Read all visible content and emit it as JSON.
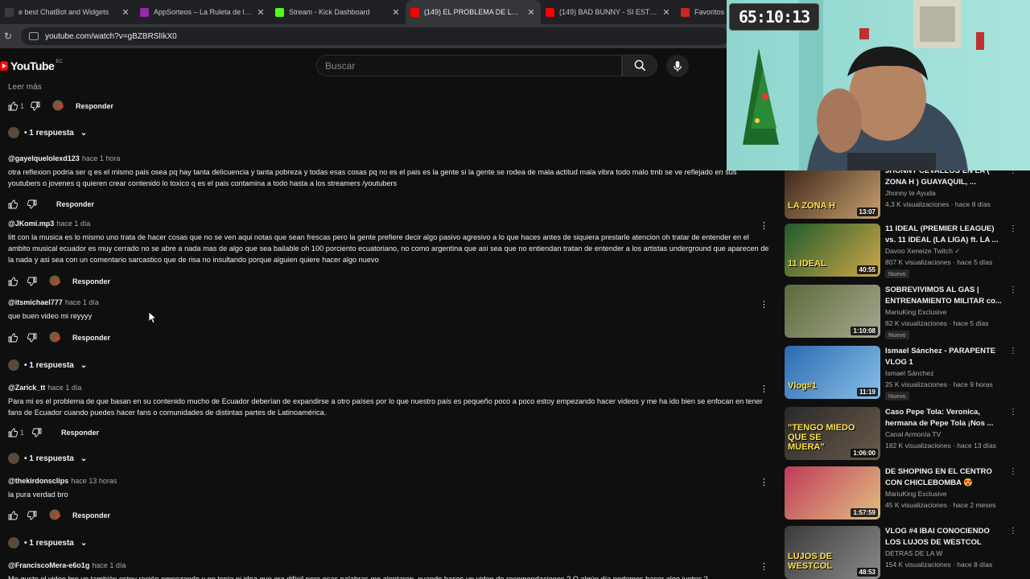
{
  "browser": {
    "tabs": [
      {
        "label": "e best ChatBot and Widgets",
        "color": "#3c3c3c",
        "active": false
      },
      {
        "label": "AppSorteos – La Ruleta de la Su",
        "color": "#9c27b0",
        "active": false
      },
      {
        "label": "Stream - Kick Dashboard",
        "color": "#53fc18",
        "active": false
      },
      {
        "label": "(149) EL PROBLEMA DE LOS STR",
        "color": "#ff0000",
        "active": true
      },
      {
        "label": "(149) BAD BUNNY - SI ESTUVIÉ",
        "color": "#ff0000",
        "active": false
      },
      {
        "label": "Favoritos | Myinst",
        "color": "#c62828",
        "active": false
      }
    ],
    "url": "youtube.com/watch?v=gBZBRSlIkX0"
  },
  "youtube": {
    "logo_text": "YouTube",
    "country_code": "EC",
    "search_placeholder": "Buscar"
  },
  "comments": {
    "read_more": "Leer más",
    "reply_label": "Responder",
    "top_action": {
      "likes": "1"
    },
    "replies_label": "• 1 respuesta",
    "items": [
      {
        "author": "@gayelquelolexd123",
        "time": "hace 1 hora",
        "text": "otra reflexion podria ser q es el mismo pais osea pq hay tanta delicuencia y tanta pobreza y todas esas cosas pq no es el pais es la gente si la gente se rodea de mala actitud mala vibra todo malo tmb se ve reflejado en sus youtubers o jovenes q quieren crear contenido lo toxico q es el pais contamina a todo hasta a los streamers /youtubers",
        "likes": ""
      },
      {
        "author": "@JKomi.mp3",
        "time": "hace 1 día",
        "text": "litt con la musica es lo mismo uno trata de hacer cosas que no se ven aqui notas que sean frescas pero la gente prefiere decir algo pasivo agresivo a lo que haces antes de siquiera prestarle atencion oh tratar de entender en el ambito musical ecuador es muy cerrado no se abre a nada mas de algo que sea bailable oh 100 porciento ecuatoriano, no como argentina que asi sea que no entiendan tratan de entender a los artistas underground que aparecen de la nada y asi sea con un comentario sarcastico que de risa no insultando porque alguien quiere hacer algo nuevo",
        "likes": ""
      },
      {
        "author": "@itsmichael777",
        "time": "hace 1 día",
        "text": "que buen video mi reyyyy",
        "likes": ""
      },
      {
        "author": "@Zarick_tt",
        "time": "hace 1 día",
        "text": "Para mi es el problema de que basan en su contenido mucho de Ecuador deberían de expandirse a otro países por lo que nuestro país es pequeño poco a poco estoy empezando hacer videos y me ha ido bien se enfocan en tener fans de Ecuador cuando puedes hacer fans o comunidades de distintas partes de Latinoamérica.",
        "likes": "1"
      },
      {
        "author": "@thekirdonsclips",
        "time": "hace 13 horas",
        "text": "la pura verdad bro",
        "likes": ""
      },
      {
        "author": "@FranciscoMera-e6o1g",
        "time": "hace 1 día",
        "text": "Me gusto el video bro yo también estoy recién empezando y no tenia ni idea que era difícil pero esas palabras me alentaron, cuando haces un video de recomendaciones ? O algún día podemos hacer algo juntos ?",
        "likes": ""
      }
    ]
  },
  "sidebar": {
    "videos": [
      {
        "title": "JHONNY CEVALLOS EN LA ( ZONA H ) GUAYAQUIL, ...",
        "channel": "Jhonny te Ayuda",
        "stats": "4,3 K visualizaciones · hace 8 días",
        "duration": "13:07",
        "badge": "",
        "thumb_text": "LA ZONA H",
        "colors": [
          "#3a2418",
          "#c8a070"
        ]
      },
      {
        "title": "11 IDEAL (PREMIER LEAGUE) vs. 11 IDEAL (LA LIGA) ft. LA ...",
        "channel": "Davoo Xeneize Twitch ✓",
        "stats": "807 K visualizaciones · hace 5 días",
        "duration": "40:55",
        "badge": "Nuevo",
        "thumb_text": "11 IDEAL",
        "colors": [
          "#1f5a2a",
          "#d0a84a"
        ]
      },
      {
        "title": "SOBREVIVIMOS AL GAS | ENTRENAMIENTO MILITAR co...",
        "channel": "MariuKing Exclusive",
        "stats": "82 K visualizaciones · hace 5 días",
        "duration": "1:10:08",
        "badge": "Nuevo",
        "thumb_text": "",
        "colors": [
          "#5a6a3a",
          "#a8a890"
        ]
      },
      {
        "title": "Ismael Sánchez - PARAPENTE VLOG 1",
        "channel": "Ismael Sánchez",
        "stats": "25 K visualizaciones · hace 9 horas",
        "duration": "11:19",
        "badge": "Nuevo",
        "thumb_text": "Vlog#1",
        "colors": [
          "#2a6ab0",
          "#8ac0e8"
        ]
      },
      {
        "title": "Caso Pepe Tola: Veronica, hermana de Pepe Tola ¡Nos ...",
        "channel": "Canal Armonía TV",
        "stats": "182 K visualizaciones · hace 13 días",
        "duration": "1:06:00",
        "badge": "",
        "thumb_text": "\"TENGO MIEDO QUE SE MUERA\"",
        "colors": [
          "#2a2a2a",
          "#6a5a4a"
        ]
      },
      {
        "title": "DE SHOPING EN EL CENTRO CON CHICLEBOMBA 😍",
        "channel": "MariuKing Exclusive",
        "stats": "45 K visualizaciones · hace 2 meses",
        "duration": "1:57:59",
        "badge": "",
        "thumb_text": "",
        "colors": [
          "#c03a5a",
          "#e0c080"
        ]
      },
      {
        "title": "VLOG #4 IBAI CONOCIENDO LOS LUJOS DE WESTCOL",
        "channel": "DETRAS DE LA W",
        "stats": "154 K visualizaciones · hace 8 días",
        "duration": "48:53",
        "badge": "",
        "thumb_text": "LUJOS DE WESTCOL",
        "colors": [
          "#3a3a3a",
          "#8a8a8a"
        ]
      }
    ]
  },
  "overlay": {
    "timer": "65:10:13"
  }
}
